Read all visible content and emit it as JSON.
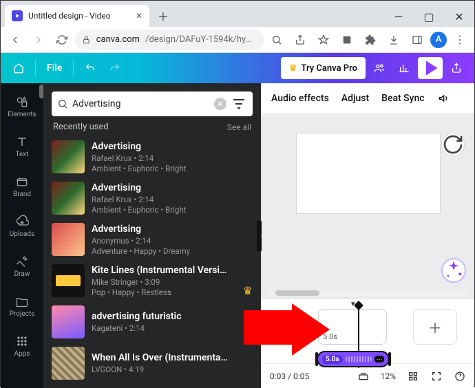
{
  "browser": {
    "tab_title": "Untitled design - Video",
    "url_domain": "canva.com",
    "url_path": "/design/DAFuY-1594k/hyAr2I…",
    "avatar_letter": "A"
  },
  "header": {
    "file_label": "File",
    "try_pro_label": "Try Canva Pro"
  },
  "rail": {
    "items": [
      {
        "id": "elements",
        "label": "Elements"
      },
      {
        "id": "text",
        "label": "Text"
      },
      {
        "id": "brand",
        "label": "Brand"
      },
      {
        "id": "uploads",
        "label": "Uploads"
      },
      {
        "id": "draw",
        "label": "Draw"
      },
      {
        "id": "projects",
        "label": "Projects"
      },
      {
        "id": "apps",
        "label": "Apps"
      }
    ]
  },
  "panel": {
    "search_value": "Advertising",
    "section_label": "Recently used",
    "see_all_label": "See all",
    "tracks": [
      {
        "title": "Advertising",
        "artist_duration": "Rafael Krux • 2:14",
        "tags": "Ambient • Euphoric • Bright",
        "thumb": "t1",
        "pro": false
      },
      {
        "title": "Advertising",
        "artist_duration": "Rafael Krux • 2:14",
        "tags": "Ambient • Euphoric • Bright",
        "thumb": "t2",
        "pro": false
      },
      {
        "title": "Advertising",
        "artist_duration": "Anonymus • 2:14",
        "tags": "Adventure • Happy • Dreamy",
        "thumb": "t3",
        "pro": false
      },
      {
        "title": "Kite Lines (Instrumental Versi…",
        "artist_duration": "Mike Stringer • 3:09",
        "tags": "Pop • Happy • Restless",
        "thumb": "t4",
        "pro": true
      },
      {
        "title": "advertising futuristic",
        "artist_duration": "Kagateni • 2:14",
        "tags": "",
        "thumb": "t5",
        "pro": false
      },
      {
        "title": "When All Is Over (Instrumenta…",
        "artist_duration": "LVGOON • 4:19",
        "tags": "",
        "thumb": "t6",
        "pro": false
      }
    ]
  },
  "context_bar": {
    "items": [
      "Audio effects",
      "Adjust",
      "Beat Sync"
    ]
  },
  "timeline": {
    "clip_duration": "5.0s",
    "audio_duration": "5.0s",
    "time_display": "0:03 / 0:05",
    "zoom_label": "12%"
  }
}
